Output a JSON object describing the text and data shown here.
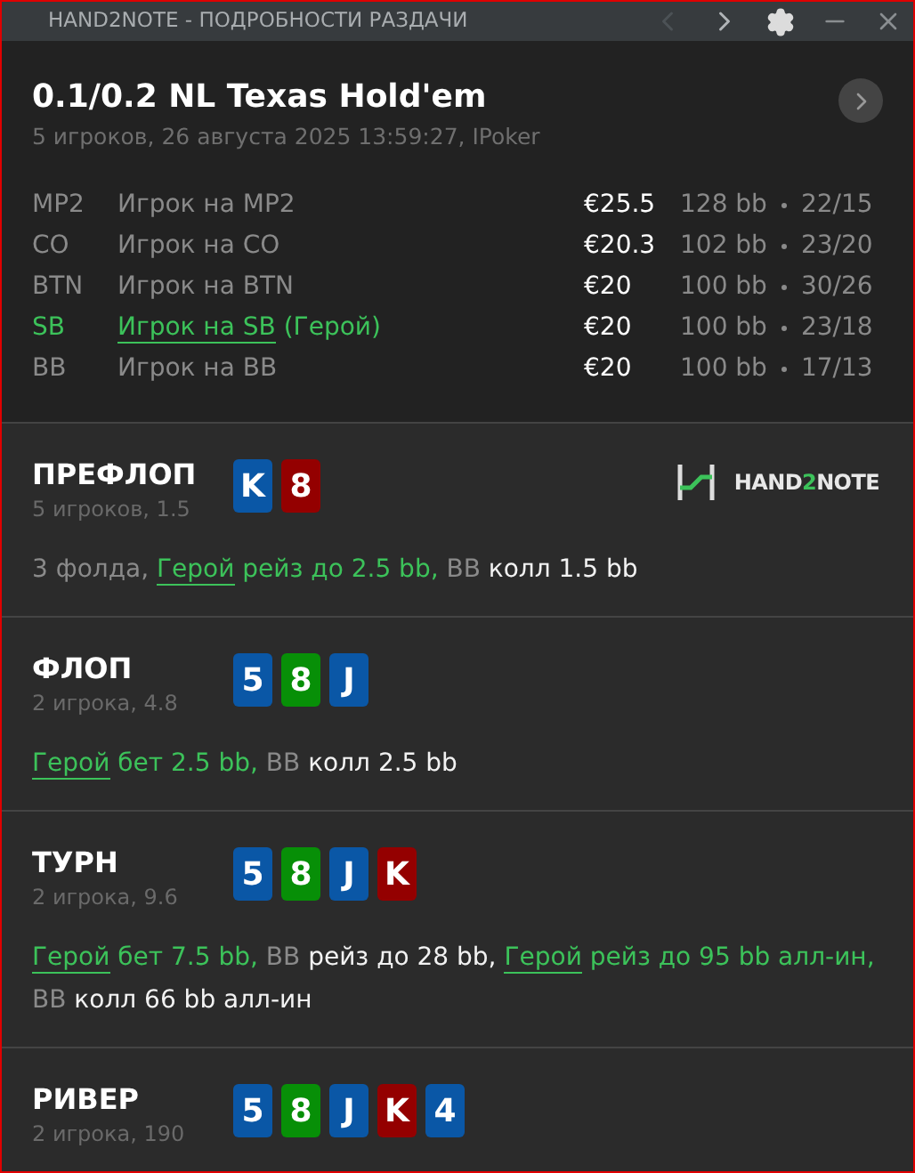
{
  "titlebar": {
    "title": "HAND2NOTE - ПОДРОБНОСТИ РАЗДАЧИ",
    "back_disabled": true,
    "forward_disabled": false
  },
  "header": {
    "title": "0.1/0.2 NL Texas Hold'em",
    "subtitle": "5 игроков, 26 августа 2025 13:59:27, IPoker"
  },
  "players": [
    {
      "position": "MP2",
      "name": "Игрок на MP2",
      "hero": false,
      "stack": "€25.5",
      "bb": "128 bb",
      "stats": "22/15"
    },
    {
      "position": "CO",
      "name": "Игрок на CO",
      "hero": false,
      "stack": "€20.3",
      "bb": "102 bb",
      "stats": "23/20"
    },
    {
      "position": "BTN",
      "name": "Игрок на BTN",
      "hero": false,
      "stack": "€20",
      "bb": "100 bb",
      "stats": "30/26"
    },
    {
      "position": "SB",
      "name": "Игрок на SB",
      "tag": "(Герой)",
      "hero": true,
      "stack": "€20",
      "bb": "100 bb",
      "stats": "23/18"
    },
    {
      "position": "BB",
      "name": "Игрок на BB",
      "hero": false,
      "stack": "€20",
      "bb": "100 bb",
      "stats": "17/13"
    }
  ],
  "streets": [
    {
      "name": "ПРЕФЛОП",
      "info": "5 игроков, 1.5",
      "logo": {
        "parts": [
          {
            "text": "HAND",
            "accent": false
          },
          {
            "text": "2",
            "accent": true
          },
          {
            "text": "NOTE",
            "accent": false
          }
        ]
      },
      "cards": [
        {
          "rank": "K",
          "color": "#0a57a6"
        },
        {
          "rank": "8",
          "color": "#940000"
        }
      ],
      "actions": [
        {
          "kind": "muted",
          "text": "3 фолда, "
        },
        {
          "kind": "hero",
          "text": "Герой"
        },
        {
          "kind": "green",
          "text": " рейз до 2.5 bb, "
        },
        {
          "kind": "muted",
          "text": "BB "
        },
        {
          "kind": "white",
          "text": "колл 1.5 bb"
        }
      ]
    },
    {
      "name": "ФЛОП",
      "info": "2 игрока, 4.8",
      "cards": [
        {
          "rank": "5",
          "color": "#0a57a6"
        },
        {
          "rank": "8",
          "color": "#078f07"
        },
        {
          "rank": "J",
          "color": "#0a57a6"
        }
      ],
      "actions": [
        {
          "kind": "hero",
          "text": "Герой"
        },
        {
          "kind": "green",
          "text": " бет 2.5 bb, "
        },
        {
          "kind": "muted",
          "text": "BB "
        },
        {
          "kind": "white",
          "text": "колл 2.5 bb"
        }
      ]
    },
    {
      "name": "ТУРН",
      "info": "2 игрока, 9.6",
      "cards": [
        {
          "rank": "5",
          "color": "#0a57a6"
        },
        {
          "rank": "8",
          "color": "#078f07"
        },
        {
          "rank": "J",
          "color": "#0a57a6"
        },
        {
          "rank": "K",
          "color": "#940000"
        }
      ],
      "actions": [
        {
          "kind": "hero",
          "text": "Герой"
        },
        {
          "kind": "green",
          "text": " бет 7.5 bb, "
        },
        {
          "kind": "muted",
          "text": "BB "
        },
        {
          "kind": "white",
          "text": "рейз до 28 bb, "
        },
        {
          "kind": "hero",
          "text": "Герой"
        },
        {
          "kind": "green",
          "text": " рейз до 95 bb алл-ин, "
        },
        {
          "kind": "muted",
          "text": "BB "
        },
        {
          "kind": "white",
          "text": "колл 66 bb алл-ин"
        }
      ]
    },
    {
      "name": "РИВЕР",
      "info": "2 игрока, 190",
      "cards": [
        {
          "rank": "5",
          "color": "#0a57a6"
        },
        {
          "rank": "8",
          "color": "#078f07"
        },
        {
          "rank": "J",
          "color": "#0a57a6"
        },
        {
          "rank": "K",
          "color": "#940000"
        },
        {
          "rank": "4",
          "color": "#0a57a6"
        }
      ]
    }
  ]
}
